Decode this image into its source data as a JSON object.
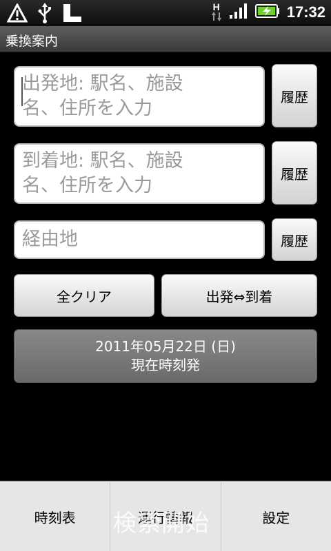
{
  "status_bar": {
    "time": "17:32",
    "network_label": "H",
    "icons": [
      "warning-icon",
      "usb-icon",
      "sd-card-icon",
      "data-arrows-icon",
      "signal-icon",
      "battery-charging-icon"
    ]
  },
  "title": "乗換案内",
  "from": {
    "placeholder": "出発地: 駅名、施設\n名、住所を入力",
    "history_label": "履歴"
  },
  "to": {
    "placeholder": "到着地: 駅名、施設\n名、住所を入力",
    "history_label": "履歴"
  },
  "via": {
    "placeholder": "経由地",
    "history_label": "履歴"
  },
  "buttons": {
    "clear_all": "全クリア",
    "swap": "出発⇔到着"
  },
  "datetime": {
    "date": "2011年05月22日 (日)",
    "mode": "現在時刻発"
  },
  "menu": {
    "items": [
      "時刻表",
      "運行情報",
      "設定"
    ],
    "hidden_action": "検索開始"
  },
  "colors": {
    "background": "#000000",
    "menu_bg": "#e6e6e6",
    "date_button": "#777777"
  }
}
